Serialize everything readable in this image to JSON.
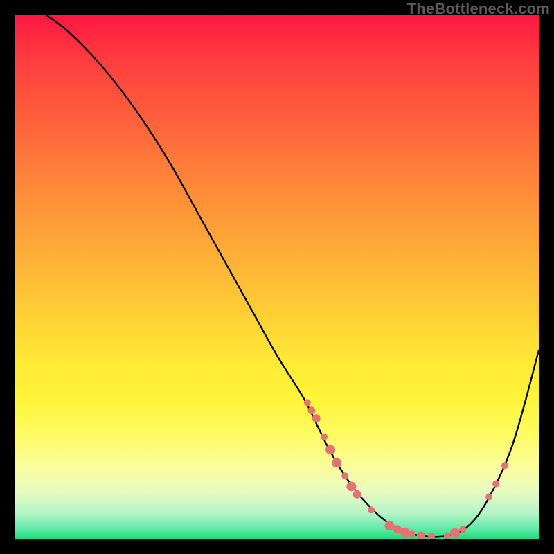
{
  "watermark": "TheBottleneck.com",
  "chart_data": {
    "type": "line",
    "title": "",
    "xlabel": "",
    "ylabel": "",
    "xlim": [
      0,
      100
    ],
    "ylim": [
      0,
      100
    ],
    "series": [
      {
        "name": "bottleneck-curve",
        "color": "#000000",
        "x": [
          6,
          10,
          15,
          20,
          25,
          30,
          35,
          40,
          45,
          50,
          55,
          58,
          60,
          63,
          66,
          70,
          74,
          78,
          82,
          86,
          90,
          95,
          100
        ],
        "y": [
          100,
          97,
          92,
          86,
          79,
          71,
          62,
          53,
          44,
          35,
          27,
          21,
          17,
          12,
          8,
          4,
          1.5,
          0.5,
          0.5,
          2,
          7,
          18,
          36
        ]
      }
    ],
    "markers": {
      "name": "highlight-points",
      "color": "#e57373",
      "points": [
        {
          "x": 55.8,
          "y": 26,
          "r": 5
        },
        {
          "x": 56.6,
          "y": 24.5,
          "r": 5.5
        },
        {
          "x": 57.5,
          "y": 23,
          "r": 6
        },
        {
          "x": 59.0,
          "y": 19.5,
          "r": 5
        },
        {
          "x": 60.2,
          "y": 17,
          "r": 7
        },
        {
          "x": 61.4,
          "y": 14.5,
          "r": 7
        },
        {
          "x": 63.0,
          "y": 12,
          "r": 5
        },
        {
          "x": 64.2,
          "y": 10,
          "r": 7
        },
        {
          "x": 65.3,
          "y": 8.5,
          "r": 6
        },
        {
          "x": 68.0,
          "y": 5.5,
          "r": 5
        },
        {
          "x": 71.5,
          "y": 2.5,
          "r": 7
        },
        {
          "x": 73.0,
          "y": 1.8,
          "r": 6
        },
        {
          "x": 74.5,
          "y": 1.2,
          "r": 7
        },
        {
          "x": 75.8,
          "y": 0.9,
          "r": 5
        },
        {
          "x": 77.5,
          "y": 0.6,
          "r": 6
        },
        {
          "x": 79.5,
          "y": 0.5,
          "r": 5
        },
        {
          "x": 82.5,
          "y": 0.6,
          "r": 5
        },
        {
          "x": 84.0,
          "y": 1.1,
          "r": 7
        },
        {
          "x": 85.5,
          "y": 1.8,
          "r": 5
        },
        {
          "x": 90.5,
          "y": 8,
          "r": 5
        },
        {
          "x": 91.8,
          "y": 10.5,
          "r": 5
        },
        {
          "x": 93.5,
          "y": 14,
          "r": 5
        }
      ]
    }
  }
}
